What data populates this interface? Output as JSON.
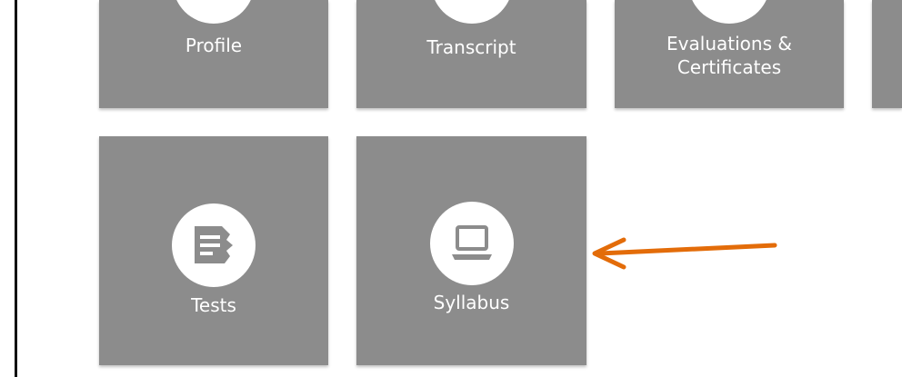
{
  "tiles": {
    "profile": {
      "label": "Profile"
    },
    "transcript": {
      "label": "Transcript"
    },
    "evaluations": {
      "label": "Evaluations &\nCertificates"
    },
    "tests": {
      "label": "Tests",
      "icon": "document-list-icon"
    },
    "syllabus": {
      "label": "Syllabus",
      "icon": "laptop-icon"
    }
  },
  "colors": {
    "tile_bg": "#8c8c8c",
    "icon_circle": "#ffffff",
    "icon_glyph": "#8c8c8c",
    "arrow": "#e36c09"
  }
}
